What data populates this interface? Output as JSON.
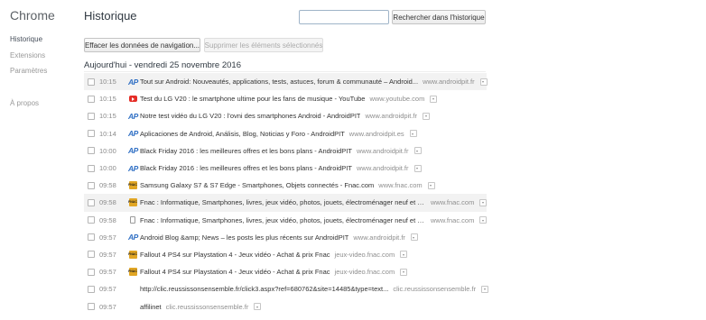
{
  "sidebar": {
    "brand": "Chrome",
    "items": [
      {
        "label": "Historique"
      },
      {
        "label": "Extensions"
      },
      {
        "label": "Paramètres"
      },
      {
        "label": "À propos"
      }
    ]
  },
  "header": {
    "title": "Historique",
    "search": {
      "value": "",
      "placeholder": ""
    },
    "search_button": "Rechercher dans l'historique"
  },
  "toolbar": {
    "clear_button": "Effacer les données de navigation...",
    "remove_selected_button": "Supprimer les éléments sélectionnés"
  },
  "day_header": "Aujourd'hui - vendredi 25 novembre 2016",
  "entries": [
    {
      "time": "10:15",
      "favicon": "androidpit-icon",
      "title": "Tout sur Android: Nouveautés, applications, tests, astuces, forum & communauté – Android...",
      "domain": "www.androidpit.fr"
    },
    {
      "time": "10:15",
      "favicon": "youtube-icon",
      "title": "Test du LG V20 : le smartphone ultime pour les fans de musique - YouTube",
      "domain": "www.youtube.com"
    },
    {
      "time": "10:15",
      "favicon": "androidpit-icon",
      "title": "Notre test vidéo du LG V20 : l'ovni des smartphones Android - AndroidPIT",
      "domain": "www.androidpit.fr"
    },
    {
      "time": "10:14",
      "favicon": "androidpit-icon",
      "title": "Aplicaciones de Android, Análisis, Blog, Noticias y Foro - AndroidPIT",
      "domain": "www.androidpit.es"
    },
    {
      "time": "10:00",
      "favicon": "androidpit-icon",
      "title": "Black Friday 2016 : les meilleures offres et les bons plans - AndroidPIT",
      "domain": "www.androidpit.fr"
    },
    {
      "time": "10:00",
      "favicon": "androidpit-icon",
      "title": "Black Friday 2016 : les meilleures offres et les bons plans - AndroidPIT",
      "domain": "www.androidpit.fr"
    },
    {
      "time": "09:58",
      "favicon": "fnac-icon",
      "title": "Samsung Galaxy S7 & S7 Edge - Smartphones, Objets connectés - Fnac.com",
      "domain": "www.fnac.com"
    },
    {
      "time": "09:58",
      "favicon": "fnac-icon",
      "title": "Fnac : Informatique, Smartphones, livres, jeux vidéo, photos, jouets, électroménager neuf et oc...",
      "domain": "www.fnac.com"
    },
    {
      "time": "09:58",
      "favicon": "page-icon",
      "title": "Fnac : Informatique, Smartphones, livres, jeux vidéo, photos, jouets, électroménager neuf et oc...",
      "domain": "www.fnac.com"
    },
    {
      "time": "09:57",
      "favicon": "androidpit-icon",
      "title": "Android Blog &amp; News – les posts les plus récents sur AndroidPIT",
      "domain": "www.androidpit.fr"
    },
    {
      "time": "09:57",
      "favicon": "fnac-icon",
      "title": "Fallout 4 PS4 sur Playstation 4 - Jeux vidéo - Achat & prix Fnac",
      "domain": "jeux-video.fnac.com"
    },
    {
      "time": "09:57",
      "favicon": "fnac-icon",
      "title": "Fallout 4 PS4 sur Playstation 4 - Jeux vidéo - Achat & prix Fnac",
      "domain": "jeux-video.fnac.com"
    },
    {
      "time": "09:57",
      "favicon": "none",
      "title": "http://clic.reussissonsensemble.fr/click3.aspx?ref=680762&site=14485&type=text...",
      "domain": "clic.reussissonsensemble.fr"
    },
    {
      "time": "09:57",
      "favicon": "none",
      "title": "affilinet",
      "domain": "clic.reussissonsensemble.fr"
    }
  ],
  "fnac_badge": "FNAC",
  "colors": {
    "accent": "#2f6fc4",
    "youtube": "#e52d27",
    "fnac": "#e1a624"
  }
}
